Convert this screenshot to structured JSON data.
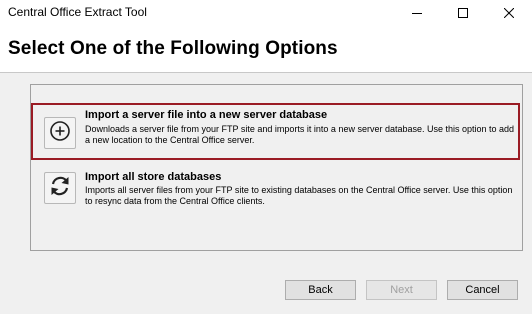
{
  "window": {
    "title": "Central Office Extract Tool"
  },
  "header": {
    "heading": "Select One of the Following Options"
  },
  "options": [
    {
      "title": "Import a server file into a new server database",
      "description": "Downloads a server file from your FTP site and imports it into a new server database. Use this option to add a new location to the Central Office server.",
      "icon": "plus-circle-icon",
      "selected": true
    },
    {
      "title": "Import all store databases",
      "description": "Imports all server files from your FTP site to existing databases on the Central Office server. Use this option to resync data from the Central Office clients.",
      "icon": "refresh-icon",
      "selected": false
    }
  ],
  "buttons": {
    "back": "Back",
    "next": "Next",
    "cancel": "Cancel"
  },
  "colors": {
    "selection_border": "#9a1b24",
    "disabled_text": "#a0a0a0"
  }
}
